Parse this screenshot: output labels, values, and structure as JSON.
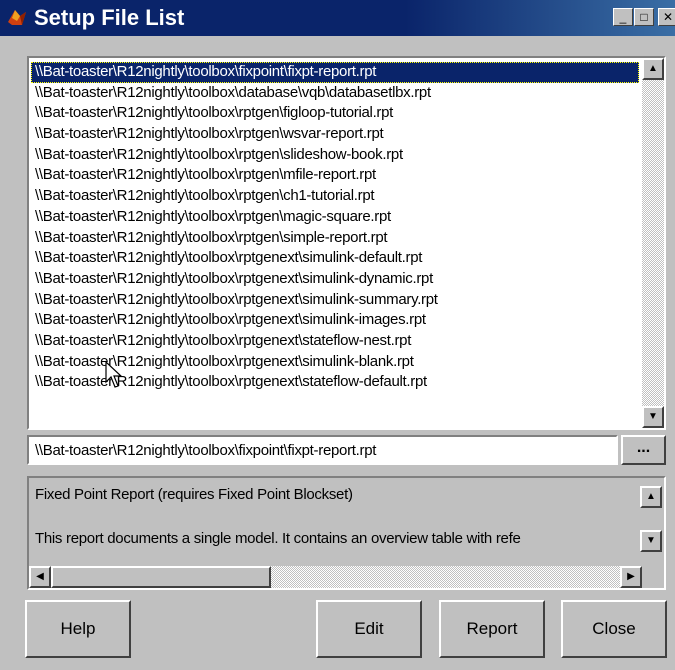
{
  "window": {
    "title": "Setup File List",
    "controls": {
      "minimize": "_",
      "maximize": "□",
      "close": "✕"
    }
  },
  "file_list": {
    "items": [
      "\\\\Bat-toaster\\R12nightly\\toolbox\\fixpoint\\fixpt-report.rpt",
      "\\\\Bat-toaster\\R12nightly\\toolbox\\database\\vqb\\databasetlbx.rpt",
      "\\\\Bat-toaster\\R12nightly\\toolbox\\rptgen\\figloop-tutorial.rpt",
      "\\\\Bat-toaster\\R12nightly\\toolbox\\rptgen\\wsvar-report.rpt",
      "\\\\Bat-toaster\\R12nightly\\toolbox\\rptgen\\slideshow-book.rpt",
      "\\\\Bat-toaster\\R12nightly\\toolbox\\rptgen\\mfile-report.rpt",
      "\\\\Bat-toaster\\R12nightly\\toolbox\\rptgen\\ch1-tutorial.rpt",
      "\\\\Bat-toaster\\R12nightly\\toolbox\\rptgen\\magic-square.rpt",
      "\\\\Bat-toaster\\R12nightly\\toolbox\\rptgen\\simple-report.rpt",
      "\\\\Bat-toaster\\R12nightly\\toolbox\\rptgenext\\simulink-default.rpt",
      "\\\\Bat-toaster\\R12nightly\\toolbox\\rptgenext\\simulink-dynamic.rpt",
      "\\\\Bat-toaster\\R12nightly\\toolbox\\rptgenext\\simulink-summary.rpt",
      "\\\\Bat-toaster\\R12nightly\\toolbox\\rptgenext\\simulink-images.rpt",
      "\\\\Bat-toaster\\R12nightly\\toolbox\\rptgenext\\stateflow-nest.rpt",
      "\\\\Bat-toaster\\R12nightly\\toolbox\\rptgenext\\simulink-blank.rpt",
      "\\\\Bat-toaster\\R12nightly\\toolbox\\rptgenext\\stateflow-default.rpt"
    ]
  },
  "selected_path": "\\\\Bat-toaster\\R12nightly\\toolbox\\fixpoint\\fixpt-report.rpt",
  "browse_label": "...",
  "description": {
    "line1": "Fixed Point Report (requires Fixed Point Blockset)",
    "line2": "This report documents a single model.  It contains an overview table with refe"
  },
  "scroll_glyphs": {
    "up": "▲",
    "down": "▼",
    "left": "◀",
    "right": "▶"
  },
  "buttons": {
    "help": "Help",
    "edit": "Edit",
    "report": "Report",
    "close": "Close"
  },
  "icons": {
    "app": "matlab-logo-icon",
    "cursor": "mouse-pointer-icon"
  },
  "colors": {
    "title_bar": "#0a246a",
    "selection": "#0a246a",
    "face": "#c0c0c0"
  }
}
